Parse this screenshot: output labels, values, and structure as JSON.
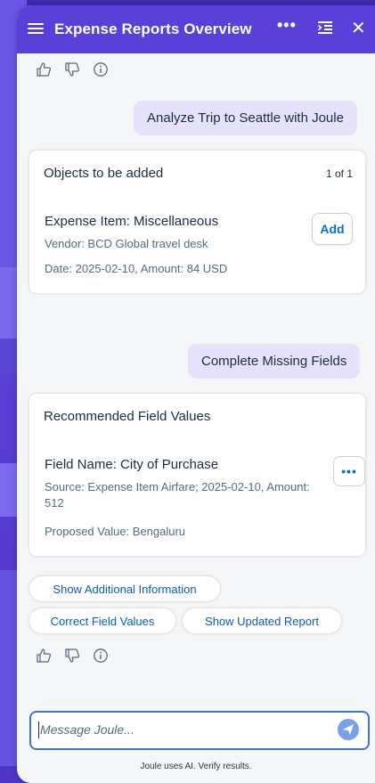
{
  "header": {
    "title": "Expense Reports Overview",
    "more_label": "•••",
    "close_label": "✕"
  },
  "messages": {
    "user_message_1": "Analyze Trip to Seattle with Joule",
    "user_message_2": "Complete Missing Fields"
  },
  "card_objects": {
    "title": "Objects to be added",
    "counter": "1 of 1",
    "item_title": "Expense Item: Miscellaneous",
    "vendor": "Vendor: BCD Global travel desk",
    "date_amount": "Date: 2025-02-10, Amount: 84 USD",
    "add_label": "Add"
  },
  "card_recommended": {
    "title": "Recommended Field Values",
    "field_name": "Field Name: City of Purchase",
    "source": "Source: Expense Item Airfare; 2025-02-10, Amount: 512",
    "proposed": "Proposed Value: Bengaluru",
    "more_label": "•••"
  },
  "suggestions": [
    {
      "label": "Show Additional Information"
    },
    {
      "label": "Correct Field Values"
    },
    {
      "label": "Show Updated Report"
    }
  ],
  "composer": {
    "placeholder": "Message Joule..."
  },
  "disclaimer": "Joule uses AI. Verify results.",
  "colors": {
    "brand": "#5b3fd9",
    "user_bubble": "#e6e2fb",
    "link": "#0a6ed1",
    "focus_border": "#3d75c7"
  }
}
